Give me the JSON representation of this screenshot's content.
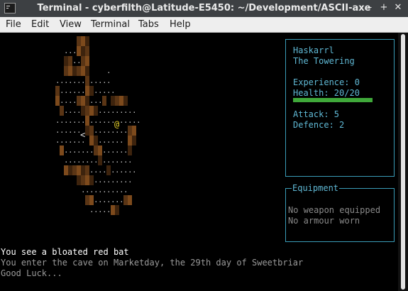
{
  "window": {
    "title": "Terminal - cyberfilth@Latitude-E5450: ~/Development/ASCII-axe",
    "controls": {
      "minimize": "–",
      "maximize": "+",
      "close": "✕"
    }
  },
  "menubar": {
    "items": [
      "File",
      "Edit",
      "View",
      "Terminal",
      "Tabs",
      "Help"
    ]
  },
  "game": {
    "player_glyph": "@",
    "stairs_glyph": "<",
    "floor_glyph": ".",
    "stats": {
      "name": "Haskarrl",
      "epithet": "The Towering",
      "experience": "Experience: 0",
      "health": "Health: 20/20",
      "health_fraction": 1.0,
      "attack": "Attack: 5",
      "defence": "Defence: 2"
    },
    "equipment": {
      "title": "Equipment",
      "weapon": "No weapon equipped",
      "armour": "No armour worn"
    },
    "messages": [
      "You see a bloated red bat",
      "You enter the cave on Marketday, the 29th day of Sweetbriar",
      "Good Luck..."
    ]
  },
  "colors": {
    "panel_border": "#3a9db8",
    "panel_text": "#5fb8d4",
    "health_bar": "#3fa83a",
    "player": "#e8d22a",
    "wall": "#5a3515",
    "message_current": "#ffffff",
    "message_old": "#9a9a9a"
  }
}
